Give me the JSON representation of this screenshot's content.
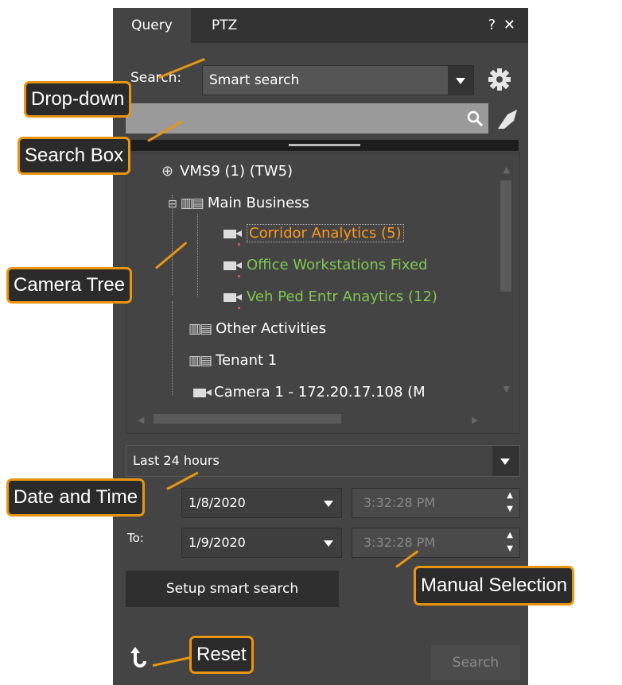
{
  "tabs": [
    {
      "label": "Query",
      "active": true
    },
    {
      "label": "PTZ",
      "active": false
    }
  ],
  "window_controls": {
    "help": "?",
    "close": "✕"
  },
  "search": {
    "label": "Search:",
    "dropdown_value": "Smart search",
    "search_input_value": "",
    "search_icon": "search-icon",
    "clear_icon": "eraser-icon",
    "settings_icon": "gear-icon"
  },
  "tree": {
    "root": "VMS9 (1) (TW5)",
    "items": [
      {
        "label": "Main Business",
        "type": "building",
        "color": "#ffffff"
      },
      {
        "label": "Corridor Analytics (5)",
        "type": "camera",
        "color": "#ff9a1a",
        "selected": true
      },
      {
        "label": "Office Workstations Fixed",
        "type": "camera",
        "color": "#7ec850"
      },
      {
        "label": "Veh Ped Entr Anaytics (12)",
        "type": "camera",
        "color": "#7ec850"
      },
      {
        "label": "Other Activities",
        "type": "building",
        "color": "#ffffff"
      },
      {
        "label": "Tenant 1",
        "type": "building",
        "color": "#ffffff"
      },
      {
        "label": "Camera 1 - 172.20.17.108 (M",
        "type": "camera",
        "color": "#ffffff"
      }
    ]
  },
  "time": {
    "range_value": "Last 24 hours",
    "from_date": "1/8/2020",
    "from_time": "3:32:28 PM",
    "to_label": "To:",
    "to_date": "1/9/2020",
    "to_time": "3:32:28 PM"
  },
  "buttons": {
    "setup": "Setup smart search",
    "search": "Search",
    "reset_icon": "reset-arrow-icon"
  },
  "callouts": {
    "dropdown": "Drop-down",
    "search_box": "Search Box",
    "camera_tree": "Camera Tree",
    "date_time": "Date and Time",
    "manual": "Manual Selection",
    "reset": "Reset"
  },
  "colors": {
    "accent": "#e89612",
    "panel": "#444444",
    "selected_text": "#ff9a1a",
    "online_text": "#7ec850"
  }
}
